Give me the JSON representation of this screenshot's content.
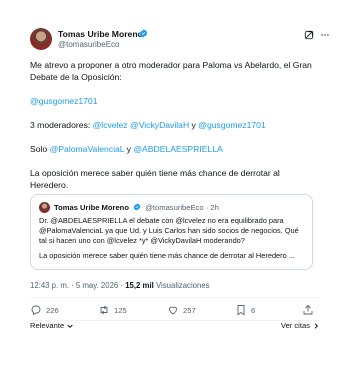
{
  "author": {
    "name": "Tomas Uribe Moreno",
    "handle": "@tomasuribeEco"
  },
  "tweet": {
    "line1": "Me atrevo a proponer a otro moderador para Paloma vs Abelardo, el Gran Debate de la Oposición:",
    "mention_gus": "@gusgomez1701",
    "moderators_prefix": "3 moderadores: ",
    "mod1": "@lcvelez",
    "mod2": "@VickyDavilaH",
    "y": " y ",
    "mod3": "@gusgomez1701",
    "solo_prefix": "Solo ",
    "solo1": "@PalomaValenciaL",
    "solo2": "@ABDELAESPRIELLA",
    "closing": "La oposición merece saber quién tiene más chance de derrotar al Heredero."
  },
  "quote": {
    "name": "Tomas Uribe Moreno",
    "handle": "@tomasuribeEco",
    "sep": "·",
    "time": "2h",
    "text": "Dr. @ABDELAESPRIELLA el debate con @lcvelez no era equilibrado para @PalomaValenciaL ya que Ud. y Luis Carlos han sido socios de negocios. Qué tal si hacen uno con @lcvelez *y* @VickyDavilaH moderando?",
    "text2": "La oposición merece saber quién tiene más chance de derrotar al Heredero ..."
  },
  "meta": {
    "datetime": "12:43 p. m. · 5 may. 2026 · ",
    "views_count": "15,2 mil",
    "views_label": " Visualizaciones"
  },
  "actions": {
    "replies": "226",
    "reposts": "125",
    "likes": "257",
    "bookmarks": "6"
  },
  "footer": {
    "sort_label": "Relevante",
    "quotes_label": "Ver citas"
  },
  "colors": {
    "accent": "#1d9bf0",
    "text": "#0f1419",
    "muted": "#536471",
    "border": "#cfd9de"
  }
}
